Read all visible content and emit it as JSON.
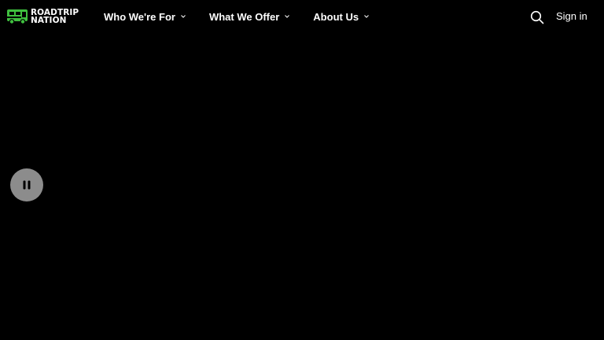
{
  "brand": {
    "line1": "ROADTRIP",
    "line2": "NATION",
    "accent_color": "#3fbf3f"
  },
  "nav": {
    "items": [
      {
        "label": "Who We're For",
        "icon": "chevron-down-icon"
      },
      {
        "label": "What We Offer",
        "icon": "chevron-down-icon"
      },
      {
        "label": "About Us",
        "icon": "chevron-down-icon"
      }
    ]
  },
  "header_actions": {
    "search_icon": "search-icon",
    "signin_label": "Sign in"
  },
  "video": {
    "control_icon": "pause-icon",
    "background_color": "#000000"
  }
}
